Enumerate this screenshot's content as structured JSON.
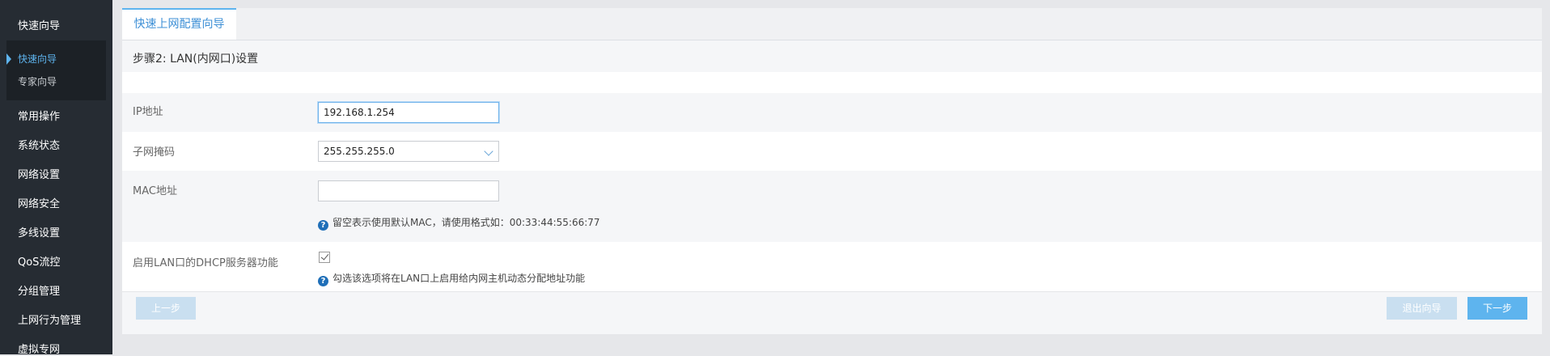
{
  "sidebar": {
    "quick_wizard_header": "快速向导",
    "sub_items": [
      "快速向导",
      "专家向导"
    ],
    "items": [
      "常用操作",
      "系统状态",
      "网络设置",
      "网络安全",
      "多线设置",
      "QoS流控",
      "分组管理",
      "上网行为管理",
      "虚拟专网"
    ]
  },
  "tab": {
    "label": "快速上网配置向导"
  },
  "step": {
    "title": "步骤2: LAN(内网口)设置"
  },
  "form": {
    "ip": {
      "label": "IP地址",
      "value": "192.168.1.254"
    },
    "subnet": {
      "label": "子网掩码",
      "value": "255.255.255.0"
    },
    "mac": {
      "label": "MAC地址",
      "value": "",
      "hint": "留空表示使用默认MAC，请使用格式如：00:33:44:55:66:77"
    },
    "dhcp": {
      "label": "启用LAN口的DHCP服务器功能",
      "checked": true,
      "hint": "勾选该选项将在LAN口上启用给内网主机动态分配地址功能"
    }
  },
  "buttons": {
    "prev": "上一步",
    "exit": "退出向导",
    "next": "下一步"
  },
  "icons": {
    "hint_icon": "question-circle-icon",
    "select_icon": "chevron-down-icon",
    "check_icon": "checkmark-icon"
  },
  "colors": {
    "accent": "#5eb4ee",
    "sidebar_bg": "#262c33",
    "hint_icon": "#1f6fb8"
  }
}
